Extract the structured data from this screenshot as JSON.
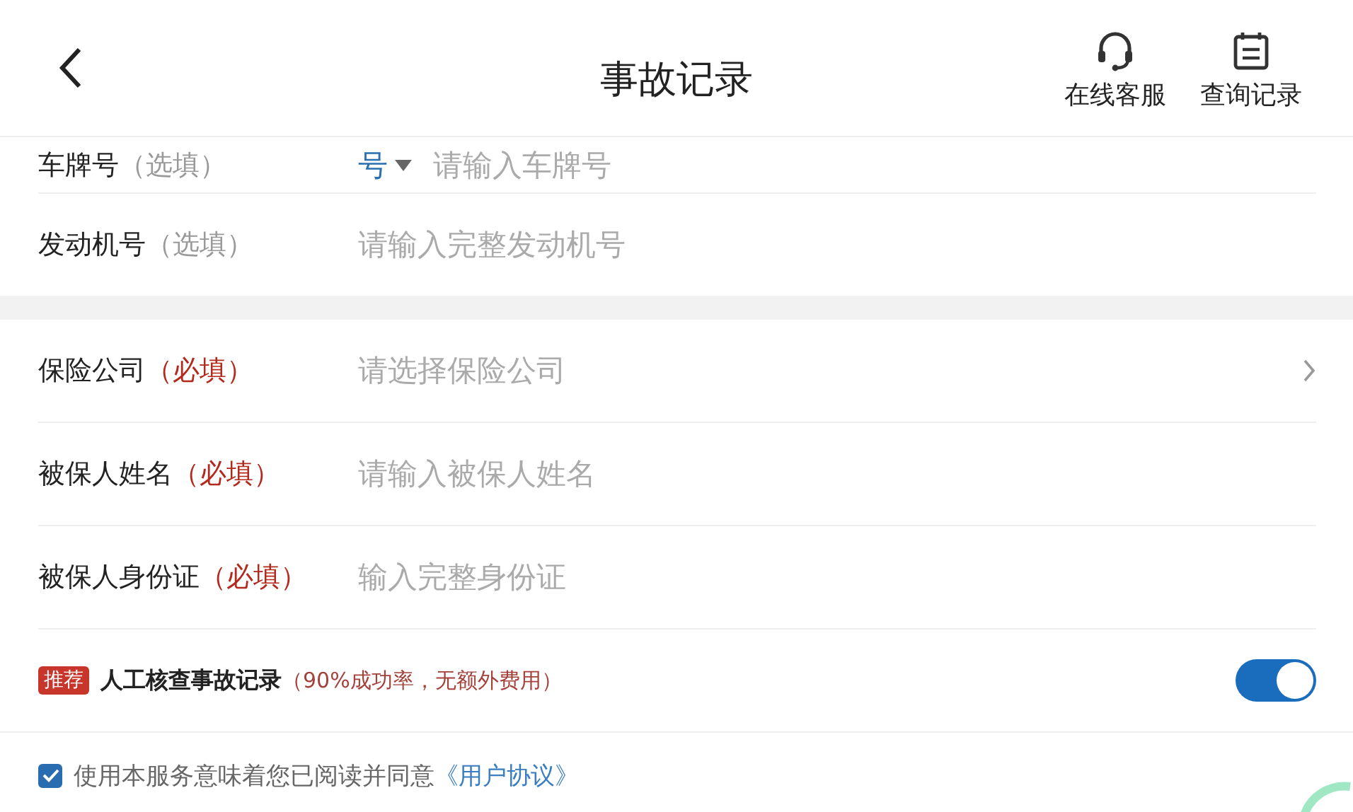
{
  "header": {
    "title": "事故记录",
    "actions": [
      {
        "kind": "headset",
        "label": "在线客服"
      },
      {
        "kind": "notepad",
        "label": "查询记录"
      }
    ]
  },
  "sections": [
    {
      "fields": [
        {
          "label": "车牌号",
          "note": "（选填）",
          "required": false,
          "prefix": "号",
          "placeholder": "请输入车牌号",
          "chevron": false
        },
        {
          "label": "发动机号",
          "note": "（选填）",
          "required": false,
          "placeholder": "请输入完整发动机号",
          "chevron": false
        }
      ]
    },
    {
      "fields": [
        {
          "label": "保险公司",
          "note": "（必填）",
          "required": true,
          "placeholder": "请选择保险公司",
          "chevron": true
        },
        {
          "label": "被保人姓名",
          "note": "（必填）",
          "required": true,
          "placeholder": "请输入被保人姓名",
          "chevron": false
        },
        {
          "label": "被保人身份证",
          "note": "（必填）",
          "required": true,
          "placeholder": "输入完整身份证",
          "chevron": false
        }
      ]
    }
  ],
  "recommendation": {
    "badge": "推荐",
    "title": "人工核查事故记录",
    "note": "（90%成功率，无额外费用）",
    "on": true
  },
  "agreement": {
    "checked": true,
    "text": "使用本服务意味着您已阅读并同意",
    "link": "《用户协议》"
  }
}
